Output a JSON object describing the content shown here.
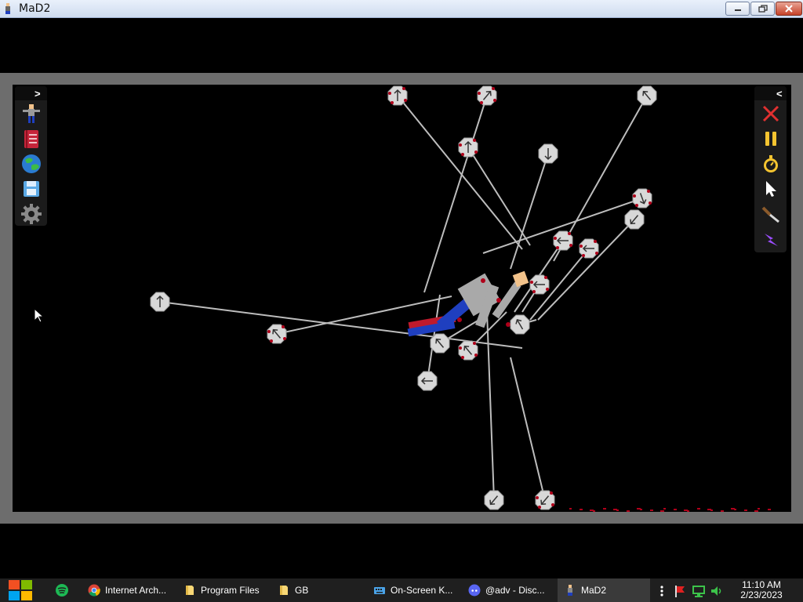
{
  "window": {
    "title": "MaD2"
  },
  "left_toolbar": {
    "expand_glyph": ">",
    "tools": [
      "character-tool",
      "book-tool",
      "world-tool",
      "save-tool",
      "settings-tool"
    ]
  },
  "right_toolbar": {
    "collapse_glyph": "<",
    "tools": [
      "close-tool",
      "pause-tool",
      "timer-tool",
      "pointer-tool",
      "knife-tool",
      "lightning-tool"
    ]
  },
  "taskbar": {
    "items": [
      {
        "label": "Internet Arch...",
        "icon": "chrome-icon"
      },
      {
        "label": "Program Files",
        "icon": "folder-icon"
      },
      {
        "label": "GB",
        "icon": "folder-icon"
      },
      {
        "label": "On-Screen K...",
        "icon": "keyboard-icon"
      },
      {
        "label": "@adv - Disc...",
        "icon": "discord-icon"
      },
      {
        "label": "MaD2",
        "icon": "mad2-icon"
      }
    ],
    "clock": {
      "time": "11:10 AM",
      "date": "2/23/2023"
    }
  },
  "colors": {
    "frame": "#6d6d6d",
    "rope": "#bdbdbd",
    "blood": "#b0001a",
    "ragdoll_body": "#a9a9a9",
    "ragdoll_pants": "#1f3fbf"
  }
}
